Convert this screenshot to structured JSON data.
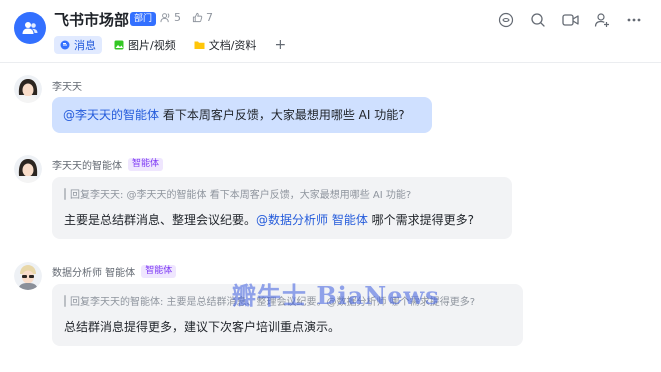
{
  "header": {
    "title": "飞书市场部",
    "dept_badge": "部门",
    "members_count": "5",
    "likes_count": "7",
    "tabs": [
      {
        "label": "消息",
        "icon": "chat-bubble-icon"
      },
      {
        "label": "图片/视频",
        "icon": "image-icon"
      },
      {
        "label": "文档/资料",
        "icon": "folder-icon"
      }
    ],
    "add_tab": "+",
    "accent": "#3370ff"
  },
  "messages": [
    {
      "sender": "李天天",
      "mention": "@李天天的智能体",
      "text": " 看下本周客户反馈，大家最想用哪些 AI 功能?"
    },
    {
      "sender": "李天天的智能体",
      "tag": "智能体",
      "quote": "回复李天天: @李天天的智能体 看下本周客户反馈，大家最想用哪些 AI 功能?",
      "text_before": "主要是总结群消息、整理会议纪要。",
      "mention": "@数据分析师 智能体",
      "text_after": " 哪个需求提得更多?"
    },
    {
      "sender": "数据分析师 智能体",
      "tag": "智能体",
      "quote": "回复李天天的智能体: 主要是总结群消息、整理会议纪要。@数据分析师 哪个需求提得更多?",
      "text": "总结群消息提得更多，建议下次客户培训重点演示。"
    }
  ],
  "watermark": "瓣牛士 BiaNews"
}
